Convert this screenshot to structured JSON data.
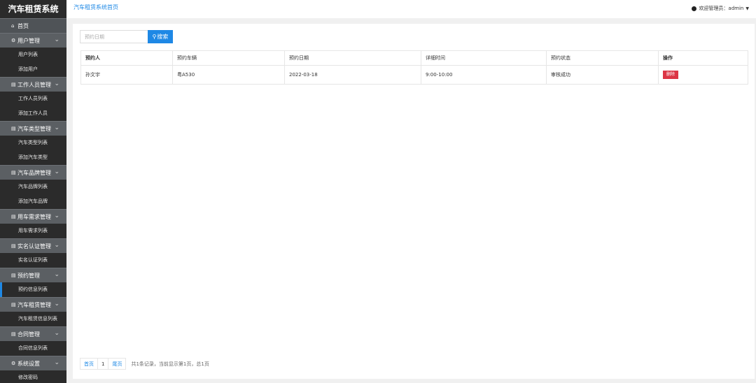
{
  "app": {
    "title": "汽车租赁系统"
  },
  "topbar": {
    "breadcrumb": "汽车租赁系统首页",
    "welcome": "欢迎管理员：admin"
  },
  "sidebar": {
    "home": "首页",
    "groups": [
      {
        "label": "用户管理",
        "items": [
          "用户列表",
          "添加用户"
        ]
      },
      {
        "label": "工作人员管理",
        "items": [
          "工作人员列表",
          "添加工作人员"
        ]
      },
      {
        "label": "汽车类型管理",
        "items": [
          "汽车类型列表",
          "添加汽车类型"
        ]
      },
      {
        "label": "汽车品牌管理",
        "items": [
          "汽车品牌列表",
          "添加汽车品牌"
        ]
      },
      {
        "label": "用车需求管理",
        "items": [
          "用车需求列表"
        ]
      },
      {
        "label": "实名认证管理",
        "items": [
          "实名认证列表"
        ]
      },
      {
        "label": "预约管理",
        "items": [
          "预约信息列表"
        ]
      },
      {
        "label": "汽车租赁管理",
        "items": [
          "汽车租赁信息列表"
        ]
      },
      {
        "label": "合同管理",
        "items": [
          "合同信息列表"
        ]
      },
      {
        "label": "系统设置",
        "items": [
          "修改密码"
        ]
      }
    ]
  },
  "search": {
    "placeholder": "预约日期",
    "button_label": "搜索"
  },
  "table": {
    "headers": [
      "预约人",
      "预约车辆",
      "预约日期",
      "详细时间",
      "预约状态",
      "操作"
    ],
    "rows": [
      {
        "person": "孙文宇",
        "vehicle": "粤A530",
        "date": "2022-03-18",
        "time": "9:00-10:00",
        "status": "审核成功",
        "action": "删除"
      }
    ]
  },
  "pagination": {
    "first": "首页",
    "page": "1",
    "last": "尾页",
    "info": "共1条记录，当前显示第1页，总1页"
  }
}
